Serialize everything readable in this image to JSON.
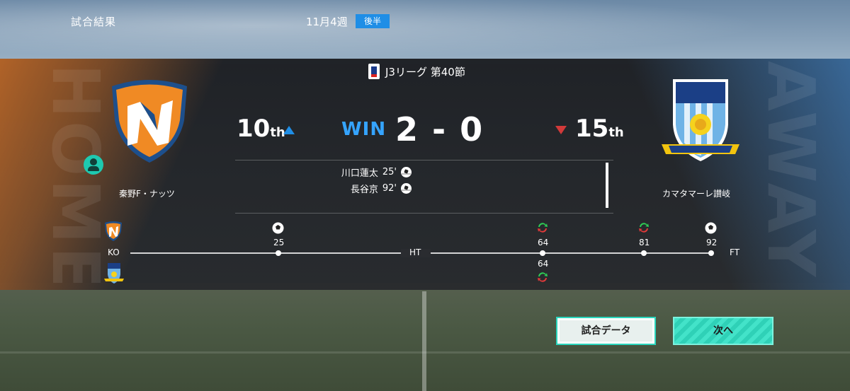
{
  "header": {
    "title": "試合結果",
    "week": "11月4週",
    "half": "後半"
  },
  "league": {
    "name": "J3リーグ 第40節"
  },
  "home": {
    "name": "秦野F・ナッツ",
    "rank": "10",
    "rank_suffix": "th",
    "deco_text": "HOME",
    "color": "#e8782a"
  },
  "away": {
    "name": "カマタマーレ讃岐",
    "rank": "15",
    "rank_suffix": "th",
    "deco_text": "AWAY",
    "color": "#4a8fd4"
  },
  "result": {
    "outcome": "WIN",
    "score": "2 - 0"
  },
  "scorers": [
    {
      "name": "川口蓮太",
      "minute": "25'"
    },
    {
      "name": "長谷京",
      "minute": "92'"
    }
  ],
  "timeline": {
    "ko": "KO",
    "ht": "HT",
    "ft": "FT",
    "events": [
      {
        "minute": "25",
        "type": "goal",
        "team": "home"
      },
      {
        "minute": "64",
        "type": "substitution",
        "team": "home"
      },
      {
        "minute": "64",
        "type": "substitution",
        "team": "away"
      },
      {
        "minute": "81",
        "type": "substitution",
        "team": "home"
      },
      {
        "minute": "92",
        "type": "goal",
        "team": "home"
      }
    ]
  },
  "buttons": {
    "match_data": "試合データ",
    "next": "次へ"
  },
  "colors": {
    "accent_blue": "#1f8ee6",
    "win": "#35a4ff",
    "down_red": "#d23a3a",
    "button_teal": "#2fd1b7"
  }
}
